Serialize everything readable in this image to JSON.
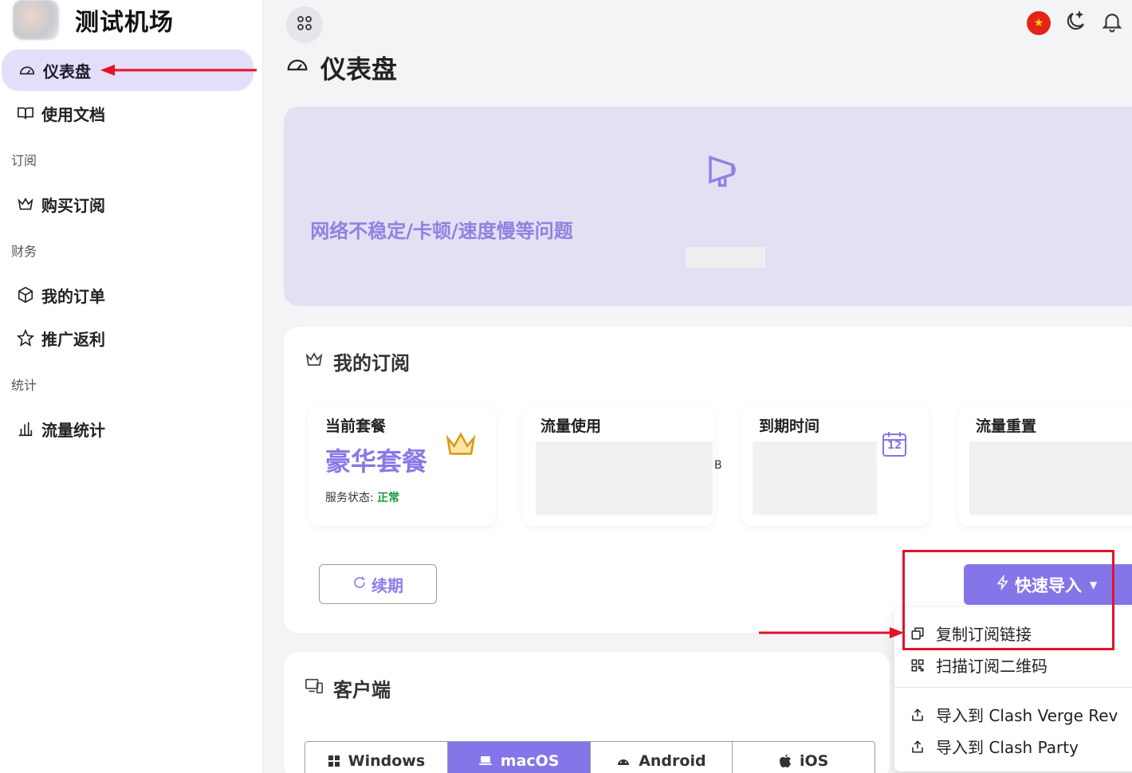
{
  "brand": {
    "title": "测试机场"
  },
  "sidebar": {
    "items": [
      {
        "label": "仪表盘"
      },
      {
        "label": "使用文档"
      },
      {
        "label": "购买订阅"
      },
      {
        "label": "我的订单"
      },
      {
        "label": "推广返利"
      },
      {
        "label": "流量统计"
      }
    ],
    "sections": [
      "订阅",
      "财务",
      "统计"
    ]
  },
  "page": {
    "title": "仪表盘"
  },
  "banner": {
    "text": "网络不稳定/卡顿/速度慢等问题"
  },
  "subscription": {
    "title": "我的订阅",
    "current_plan_label": "当前套餐",
    "plan_name": "豪华套餐",
    "status_label": "服务状态: ",
    "status_value": "正常",
    "traffic_label": "流量使用",
    "traffic_partial": "B",
    "expiry_label": "到期时间",
    "calendar_day": "12",
    "reset_label": "流量重置",
    "renew_label": "续期",
    "quick_import_label": "快速导入"
  },
  "dropdown": {
    "items": [
      {
        "label": "复制订阅链接"
      },
      {
        "label": "扫描订阅二维码"
      },
      {
        "label": "导入到 Clash Verge Rev"
      },
      {
        "label": "导入到 Clash Party"
      }
    ]
  },
  "clients": {
    "title": "客户端",
    "tabs": [
      {
        "label": "Windows"
      },
      {
        "label": "macOS"
      },
      {
        "label": "Android"
      },
      {
        "label": "iOS"
      }
    ]
  },
  "colors": {
    "accent": "#8476e8",
    "annotation": "#e2132a",
    "status_ok": "#189a3c"
  }
}
